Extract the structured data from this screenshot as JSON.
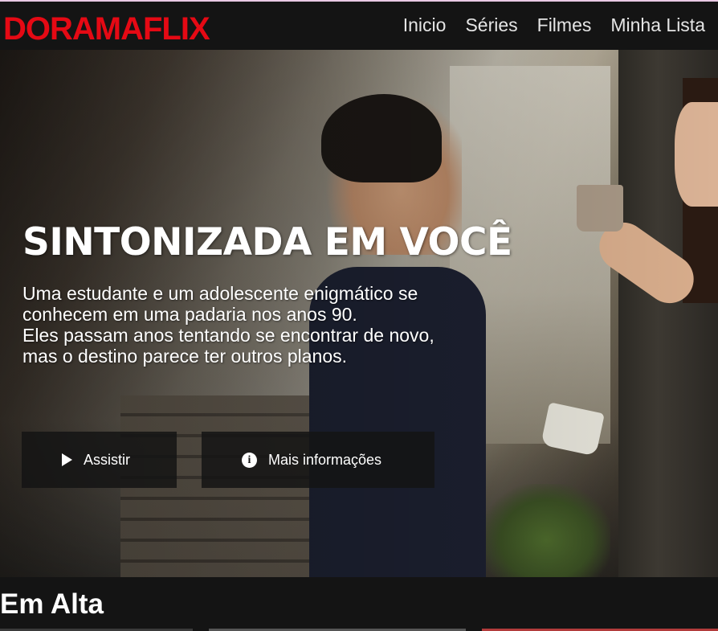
{
  "header": {
    "logo": "DORAMAFLIX",
    "nav": [
      "Inicio",
      "Séries",
      "Filmes",
      "Minha Lista"
    ]
  },
  "hero": {
    "title": "SINTONIZADA EM VOCÊ",
    "description_lines": [
      "Uma estudante e um adolescente enigmático se",
      "conhecem em uma padaria nos anos 90.",
      "Eles passam anos tentando se encontrar de novo,",
      "mas o destino parece ter outros planos."
    ],
    "buttons": {
      "play_label": "Assistir",
      "info_label": "Mais informações"
    }
  },
  "section": {
    "title": "Em Alta"
  },
  "colors": {
    "brand": "#e50914",
    "background": "#141414"
  },
  "icons": {
    "play": "play-icon",
    "info": "info-icon"
  }
}
